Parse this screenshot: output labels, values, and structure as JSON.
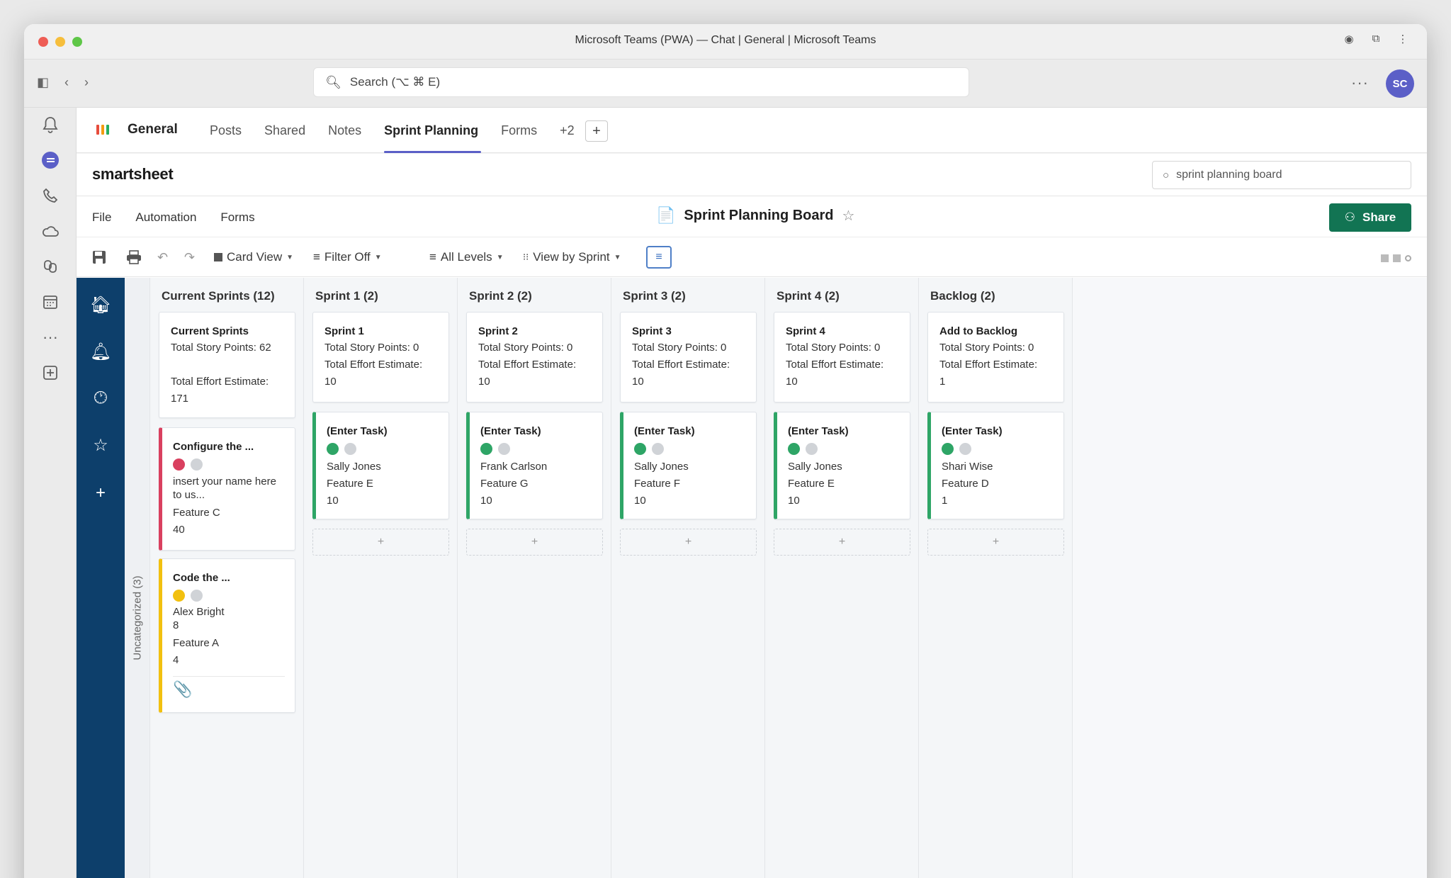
{
  "window": {
    "title": "Microsoft Teams (PWA) — Chat | General | Microsoft Teams"
  },
  "topbar": {
    "search_placeholder": "Search (⌥ ⌘ E)",
    "avatar_initials": "SC",
    "more_label": "···"
  },
  "rail": {
    "items": [
      {
        "icon": "bell-icon",
        "glyph": "🔔"
      },
      {
        "icon": "chat-icon",
        "glyph": ""
      },
      {
        "icon": "phone-icon",
        "glyph": "✆"
      },
      {
        "icon": "cloud-icon",
        "glyph": "☁"
      },
      {
        "icon": "copilot-icon",
        "glyph": "⚙"
      },
      {
        "icon": "calendar-icon",
        "glyph": "▦"
      },
      {
        "icon": "more-apps-icon",
        "glyph": "···"
      },
      {
        "icon": "add-app-icon",
        "glyph": "⊞"
      }
    ]
  },
  "channel": {
    "name": "General",
    "tabs": [
      "Posts",
      "Shared",
      "Notes",
      "Sprint Planning",
      "Forms",
      "+2"
    ],
    "active_tab": "Sprint Planning",
    "add_tab": "+"
  },
  "smartsheet": {
    "logo": "smartsheet",
    "search_value": "sprint planning board",
    "menu": [
      "File",
      "Automation",
      "Forms"
    ],
    "sheet_title": "Sprint Planning Board",
    "share_label": "Share",
    "toolbar": {
      "card_view": "Card View",
      "filter": "Filter Off",
      "levels": "All Levels",
      "view_by": "View by Sprint"
    },
    "uncategorized_label": "Uncategorized (3)"
  },
  "board": {
    "columns": [
      {
        "header": "Current Sprints (12)",
        "summary": {
          "title": "Current Sprints",
          "line1": "Total Story Points: 62",
          "line2": "",
          "line3": "Total Effort Estimate:",
          "line4": "171"
        },
        "cards": [
          {
            "title": "Configure the ...",
            "status": "red",
            "desc": "insert your name here to us...",
            "feature": "Feature C",
            "value": "40",
            "accent": "#d9405f"
          },
          {
            "title": "Code the ...",
            "status": "yellow",
            "assignee": "Alex Bright",
            "extra": "8",
            "feature": "Feature A",
            "value": "4",
            "accent": "#f2c00f",
            "attachment": true
          }
        ]
      },
      {
        "header": "Sprint 1 (2)",
        "summary": {
          "title": "Sprint 1",
          "line1": "Total Story Points: 0",
          "line2": "Total Effort Estimate:",
          "line3": "10"
        },
        "task": {
          "title": "(Enter Task)",
          "assignee": "Sally Jones",
          "feature": "Feature E",
          "value": "10"
        }
      },
      {
        "header": "Sprint 2 (2)",
        "summary": {
          "title": "Sprint 2",
          "line1": "Total Story Points: 0",
          "line2": "Total Effort Estimate:",
          "line3": "10"
        },
        "task": {
          "title": "(Enter Task)",
          "assignee": "Frank Carlson",
          "feature": "Feature G",
          "value": "10"
        }
      },
      {
        "header": "Sprint 3 (2)",
        "summary": {
          "title": "Sprint 3",
          "line1": "Total Story Points: 0",
          "line2": "Total Effort Estimate:",
          "line3": "10"
        },
        "task": {
          "title": "(Enter Task)",
          "assignee": "Sally Jones",
          "feature": "Feature F",
          "value": "10"
        }
      },
      {
        "header": "Sprint 4 (2)",
        "summary": {
          "title": "Sprint 4",
          "line1": "Total Story Points: 0",
          "line2": "Total Effort Estimate:",
          "line3": "10"
        },
        "task": {
          "title": "(Enter Task)",
          "assignee": "Sally Jones",
          "feature": "Feature E",
          "value": "10"
        }
      },
      {
        "header": "Backlog (2)",
        "summary": {
          "title": "Add to Backlog",
          "line1": "Total Story Points: 0",
          "line2": "Total Effort Estimate:",
          "line3": "1"
        },
        "task": {
          "title": "(Enter Task)",
          "assignee": "Shari Wise",
          "feature": "Feature D",
          "value": "1"
        }
      }
    ],
    "add_label": "+"
  },
  "colors": {
    "teams_accent": "#5b5fc7",
    "share_green": "#127453",
    "nav_blue": "#0d3f6b",
    "status_green": "#2ea566"
  }
}
